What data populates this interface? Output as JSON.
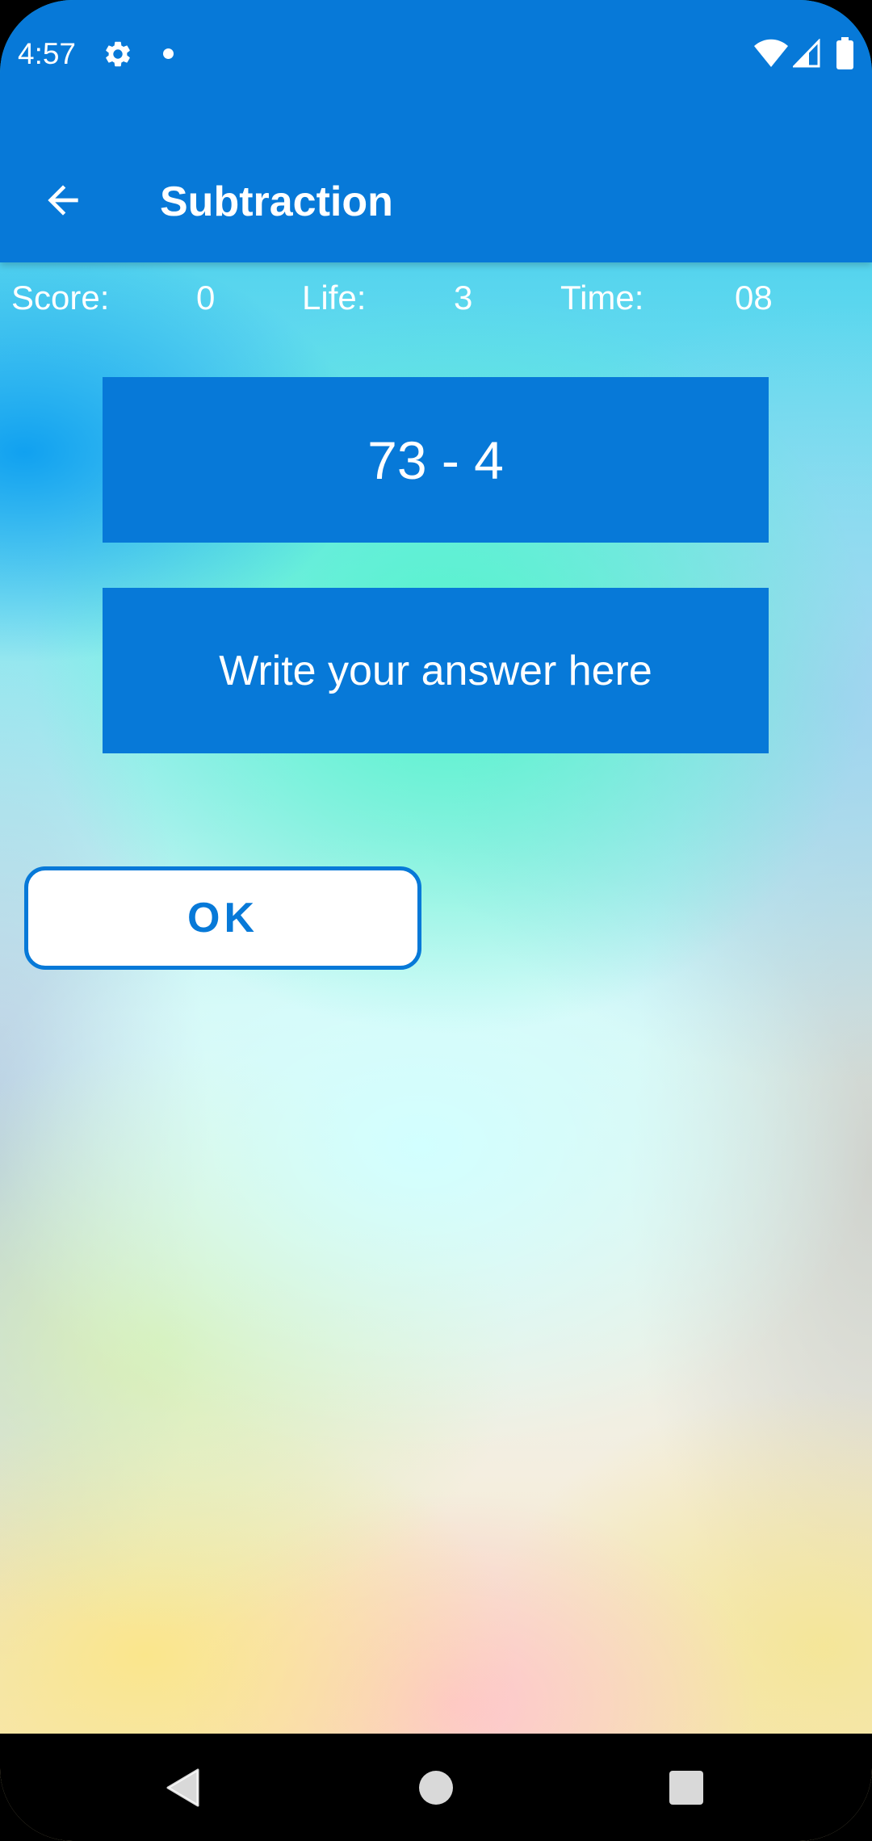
{
  "status_bar": {
    "time": "4:57",
    "icons": [
      "gear-icon",
      "notification-dot-icon",
      "wifi-icon",
      "signal-icon",
      "battery-icon"
    ]
  },
  "app_bar": {
    "title": "Subtraction",
    "back_icon": "arrow-left-icon"
  },
  "stats": {
    "score_label": "Score:",
    "score_value": "0",
    "life_label": "Life:",
    "life_value": "3",
    "time_label": "Time:",
    "time_value": "08"
  },
  "question": {
    "text": "73 - 4"
  },
  "answer": {
    "value": "",
    "placeholder": "Write your answer here"
  },
  "ok_button": {
    "label": "OK"
  },
  "nav_bar": {
    "icons": [
      "back-triangle-icon",
      "home-circle-icon",
      "recents-square-icon"
    ]
  },
  "colors": {
    "primary": "#0779d8",
    "on_primary": "#ffffff",
    "button_background": "#ffffff"
  }
}
